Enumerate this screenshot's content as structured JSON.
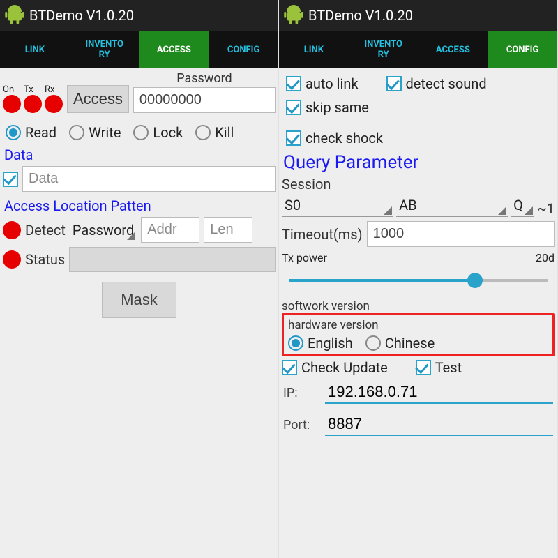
{
  "app_title": "BTDemo V1.0.20",
  "tabs": {
    "link": "LINK",
    "inventory": "INVENTO\nRY",
    "access": "ACCESS",
    "config": "CONFIG"
  },
  "left": {
    "status": {
      "on": "On",
      "tx": "Tx",
      "rx": "Rx"
    },
    "access_btn": "Access",
    "password_label": "Password",
    "password_value": "00000000",
    "ops": {
      "read": "Read",
      "write": "Write",
      "lock": "Lock",
      "kill": "Kill"
    },
    "data_heading": "Data",
    "data_placeholder": "Data",
    "loc_heading": "Access Location Patten",
    "detect_label": "Detect",
    "addr_placeholder": "Addr",
    "len_placeholder": "Len",
    "mem_spinner": "Password",
    "status_label": "Status",
    "mask_btn": "Mask"
  },
  "right": {
    "checks": {
      "auto_link": "auto link",
      "detect_sound": "detect sound",
      "skip_same": "skip same",
      "check_shock": "check shock"
    },
    "qp_heading": "Query Parameter",
    "session_label": "Session",
    "session_val": "S0",
    "ab_val": "AB",
    "q_label": "Q",
    "q_val": "~1",
    "timeout_label": "Timeout(ms)",
    "timeout_val": "1000",
    "txpower_label": "Tx power",
    "txpower_val": "20d",
    "softwork": "softwork version",
    "hardware": "hardware version",
    "lang": {
      "en": "English",
      "zh": "Chinese"
    },
    "check_update": "Check Update",
    "test": "Test",
    "ip_label": "IP:",
    "ip_value": "192.168.0.71",
    "port_label": "Port:",
    "port_value": "8887"
  }
}
